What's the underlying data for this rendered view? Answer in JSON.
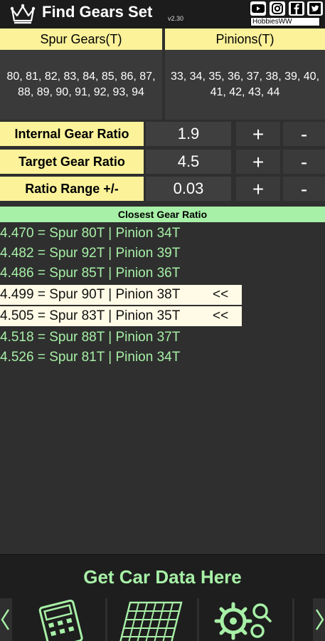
{
  "header": {
    "title": "Find Gears Set",
    "version": "v2.30",
    "brand_tag": "HobbiesWW",
    "icons": [
      "crown-icon",
      "youtube-icon",
      "instagram-icon",
      "facebook-icon",
      "twitter-icon"
    ]
  },
  "gears": {
    "spur_header": "Spur Gears(T)",
    "spur_values": "80, 81, 82, 83, 84, 85, 86, 87, 88, 89, 90, 91, 92, 93, 94",
    "pinion_header": "Pinions(T)",
    "pinion_values": "33, 34, 35, 36, 37, 38, 39, 40, 41, 42, 43, 44"
  },
  "ratios": [
    {
      "label": "Internal Gear Ratio",
      "value": "1.9",
      "plus": "+",
      "minus": "-"
    },
    {
      "label": "Target Gear Ratio",
      "value": "4.5",
      "plus": "+",
      "minus": "-"
    },
    {
      "label": "Ratio Range +/-",
      "value": "0.03",
      "plus": "+",
      "minus": "-"
    }
  ],
  "results": {
    "header": "Closest Gear Ratio",
    "items": [
      {
        "text": "4.470 = Spur 80T  |  Pinion 34T",
        "highlight": false,
        "marker": ""
      },
      {
        "text": "4.482 = Spur 92T  |  Pinion 39T",
        "highlight": false,
        "marker": ""
      },
      {
        "text": "4.486 = Spur 85T  |  Pinion 36T",
        "highlight": false,
        "marker": ""
      },
      {
        "text": "4.499 = Spur 90T  |  Pinion 38T",
        "highlight": true,
        "marker": "<<"
      },
      {
        "text": "4.505 = Spur 83T  |  Pinion 35T",
        "highlight": true,
        "marker": "<<"
      },
      {
        "text": "4.518 = Spur 88T  |  Pinion 37T",
        "highlight": false,
        "marker": ""
      },
      {
        "text": "4.526 = Spur 81T  |  Pinion 34T",
        "highlight": false,
        "marker": ""
      }
    ]
  },
  "bottom": {
    "car_data_label": "Get Car Data Here",
    "nav_icons": [
      "calculator-icon",
      "grid-table-icon",
      "gears-search-icon"
    ]
  },
  "colors": {
    "yellow": "#fbf29a",
    "green": "#a7f0a7",
    "highlight": "#fffbe6",
    "dark": "#2f2f2f"
  }
}
